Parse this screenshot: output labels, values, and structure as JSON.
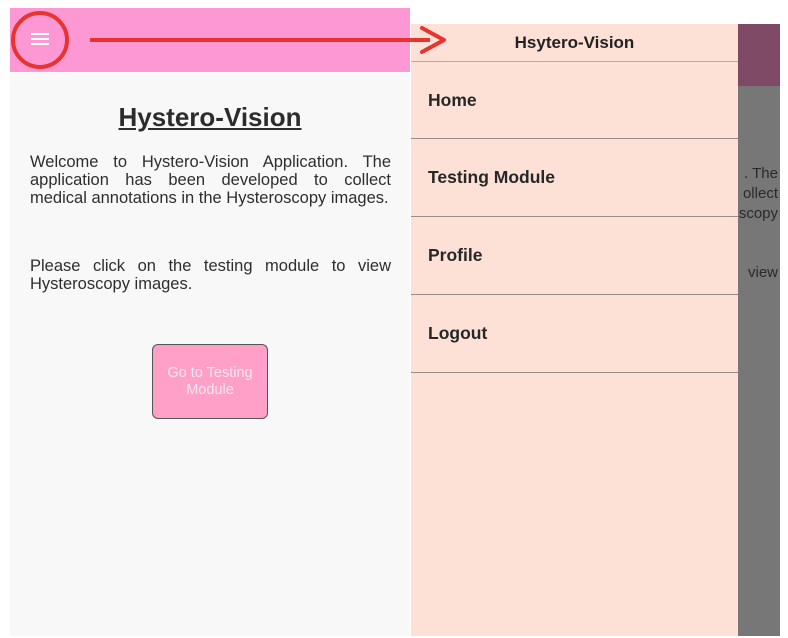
{
  "home": {
    "title": "Hystero-Vision",
    "paragraph1": "Welcome to Hystero-Vision Application. The application has been developed to collect medical annotations in the Hysteroscopy images.",
    "paragraph2": "Please click on the testing module to view Hysteroscopy images.",
    "button_label": "Go to Testing Module"
  },
  "drawer": {
    "title": "Hsytero-Vision",
    "items": [
      {
        "label": "Home"
      },
      {
        "label": "Testing Module"
      },
      {
        "label": "Profile"
      },
      {
        "label": "Logout"
      }
    ]
  },
  "dimmed_background": {
    "fragments": [
      ". The",
      "ollect",
      "scopy",
      "view"
    ]
  },
  "icons": {
    "menu": "hamburger-menu-icon"
  },
  "colors": {
    "app_bar": "#fe98d4",
    "button_bg": "#fea0c8",
    "drawer_bg": "#fde0d6",
    "annotation": "#e8332f"
  }
}
